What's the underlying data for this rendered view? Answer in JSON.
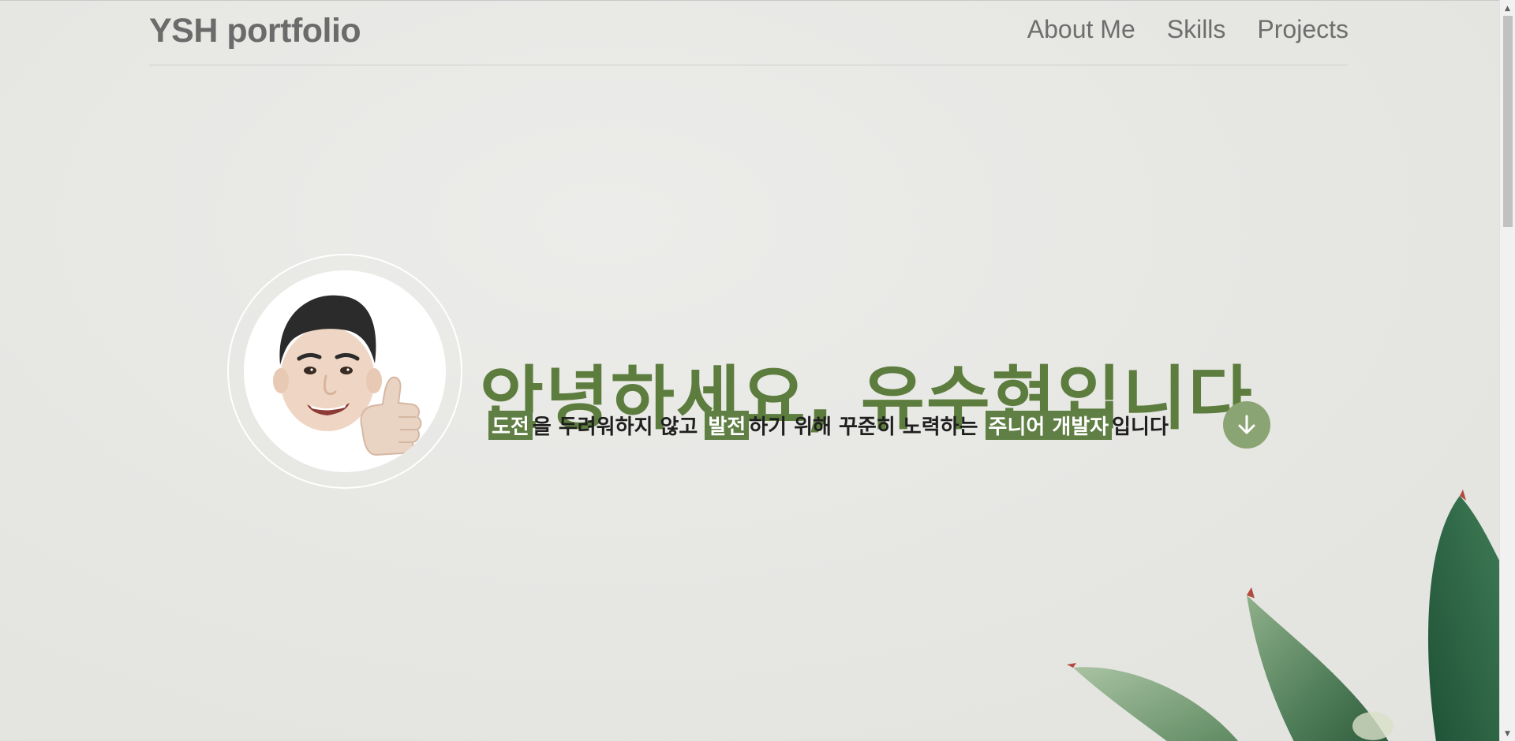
{
  "header": {
    "logo": "YSH portfolio",
    "nav": [
      {
        "label": "About Me"
      },
      {
        "label": "Skills"
      },
      {
        "label": "Projects"
      }
    ]
  },
  "hero": {
    "title": "안녕하세요, 유수현입니다",
    "subtitle": {
      "hl1": "도전",
      "t1": "을 두려워하지 않고 ",
      "hl2": "발전",
      "t2": "하기 위해 꾸준히 노력하는 ",
      "hl3": "주니어 개발자",
      "t3": "입니다"
    },
    "scroll_button_icon": "arrow-down-icon",
    "avatar_icon": "memoji-thumbs-up-avatar"
  },
  "colors": {
    "accent": "#5d7d3e",
    "highlight_bg": "#607f45",
    "button_bg": "#8ba473",
    "nav_text": "#6e6e6e"
  }
}
